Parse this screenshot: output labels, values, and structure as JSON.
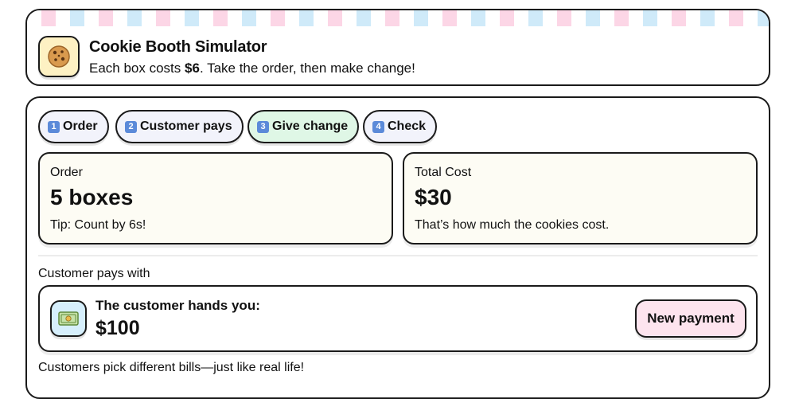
{
  "header": {
    "title": "Cookie Booth Simulator",
    "subtitle_prefix": "Each box costs ",
    "price": "$6",
    "subtitle_suffix": ". Take the order, then make change!"
  },
  "tabs": [
    {
      "num": "1",
      "label": "Order",
      "active": false
    },
    {
      "num": "2",
      "label": "Customer pays",
      "active": false
    },
    {
      "num": "3",
      "label": "Give change",
      "active": true
    },
    {
      "num": "4",
      "label": "Check",
      "active": false
    }
  ],
  "order_card": {
    "label": "Order",
    "value": "5 boxes",
    "note": "Tip: Count by 6s!"
  },
  "total_card": {
    "label": "Total Cost",
    "value": "$30",
    "note": "That’s how much the cookies cost."
  },
  "payment": {
    "section_label": "Customer pays with",
    "hands_label": "The customer hands you:",
    "amount": "$100",
    "new_payment_label": "New payment"
  },
  "footnote": "Customers pick different bills—just like real life!",
  "icons": {
    "logo": "cookie-icon",
    "payment": "dollar-bill-icon"
  },
  "colors": {
    "active_tab": "#dff7e6",
    "inactive_tab": "#f2f3fb",
    "info_card_bg": "#fdfcf4",
    "logo_bg": "#fdf1c3",
    "money_icon_bg": "#d6effc",
    "new_payment_bg": "#fde4ee",
    "stripe_pink": "#fcd6e6",
    "stripe_blue": "#cfeaf9",
    "badge_blue": "#5b8ad9"
  }
}
